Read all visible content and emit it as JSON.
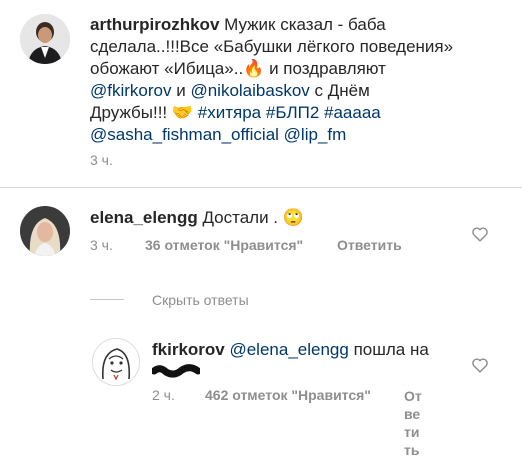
{
  "post": {
    "username": "arthurpirozhkov",
    "text_1": " Мужик сказал - баба",
    "text_2": "сделала..!!!Все «Бабушки лёгкого поведения»",
    "text_3": "обожают «Ибица»..",
    "emoji_fire": "🔥",
    "text_4": " и поздравляют",
    "mention_1": "@fkirkorov",
    "and": " и ",
    "mention_2": "@nikolaibaskov",
    "text_5": " с Днём",
    "text_6": "Дружбы!!! ",
    "emoji_hands": "🤝",
    "hashtags": " #хитяра #БЛП2 #ааааа",
    "mention_3": "@sasha_fishman_official",
    "mention_4": " @lip_fm",
    "time": "3 ч."
  },
  "comment": {
    "username": "elena_elengg",
    "text": " Достали . ",
    "emoji": "🙄",
    "time": "3 ч.",
    "likes": "36 отметок \"Нравится\"",
    "reply": "Ответить"
  },
  "hide_replies": "Скрыть ответы",
  "reply_comment": {
    "username": "fkirkorov",
    "mention": " @elena_elengg",
    "text": " пошла на",
    "time": "2 ч.",
    "likes": "462 отметок \"Нравится\"",
    "reply_lines": [
      "От",
      "ве",
      "ти",
      "ть"
    ]
  }
}
